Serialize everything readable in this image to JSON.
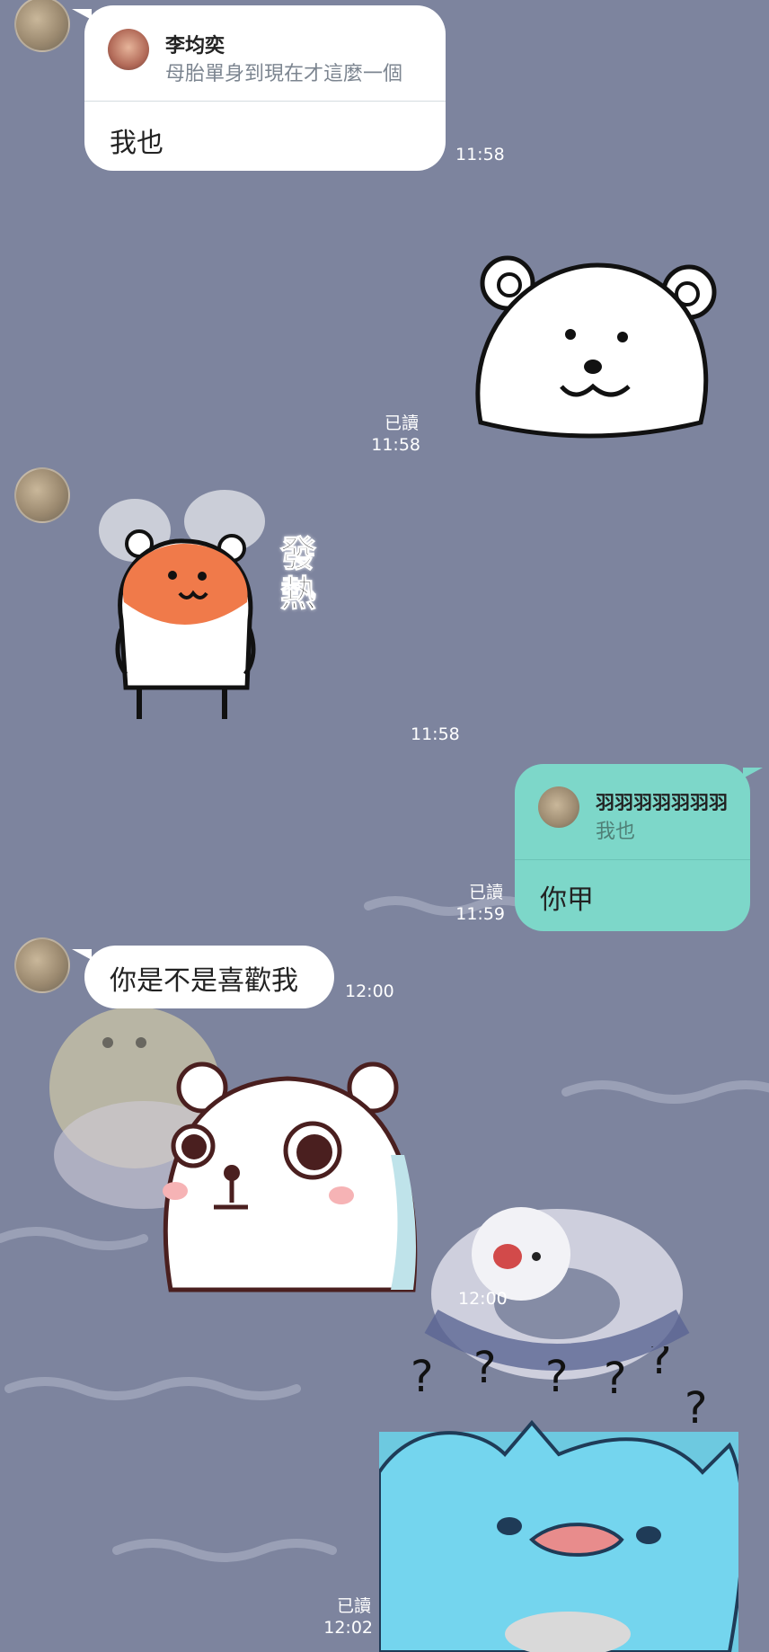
{
  "messages": {
    "m1": {
      "reply_name": "李均奕",
      "reply_text": "母胎單身到現在才這麼一個",
      "text": "我也",
      "time": "11:58"
    },
    "m2": {
      "read": "已讀",
      "time": "11:58"
    },
    "m3": {
      "sticker_text": "發熱",
      "time": "11:58"
    },
    "m4": {
      "reply_name": "羽羽羽羽羽羽羽",
      "reply_text": "我也",
      "text": "你甲",
      "read": "已讀",
      "time": "11:59"
    },
    "m5": {
      "text": "你是不是喜歡我",
      "time": "12:00"
    },
    "m6": {
      "time": "12:00"
    },
    "m7": {
      "read": "已讀",
      "time": "12:02"
    }
  },
  "colors": {
    "background": "#7d849e",
    "incoming_bubble": "#ffffff",
    "outgoing_bubble": "#7dd7c9"
  },
  "icons": {
    "avatar": "avatar-icon",
    "bear": "polar-bear-sticker",
    "hamster": "hamster-sticker",
    "surprised_bear": "surprised-bear-sticker",
    "blue_cat": "blue-cat-sticker"
  }
}
